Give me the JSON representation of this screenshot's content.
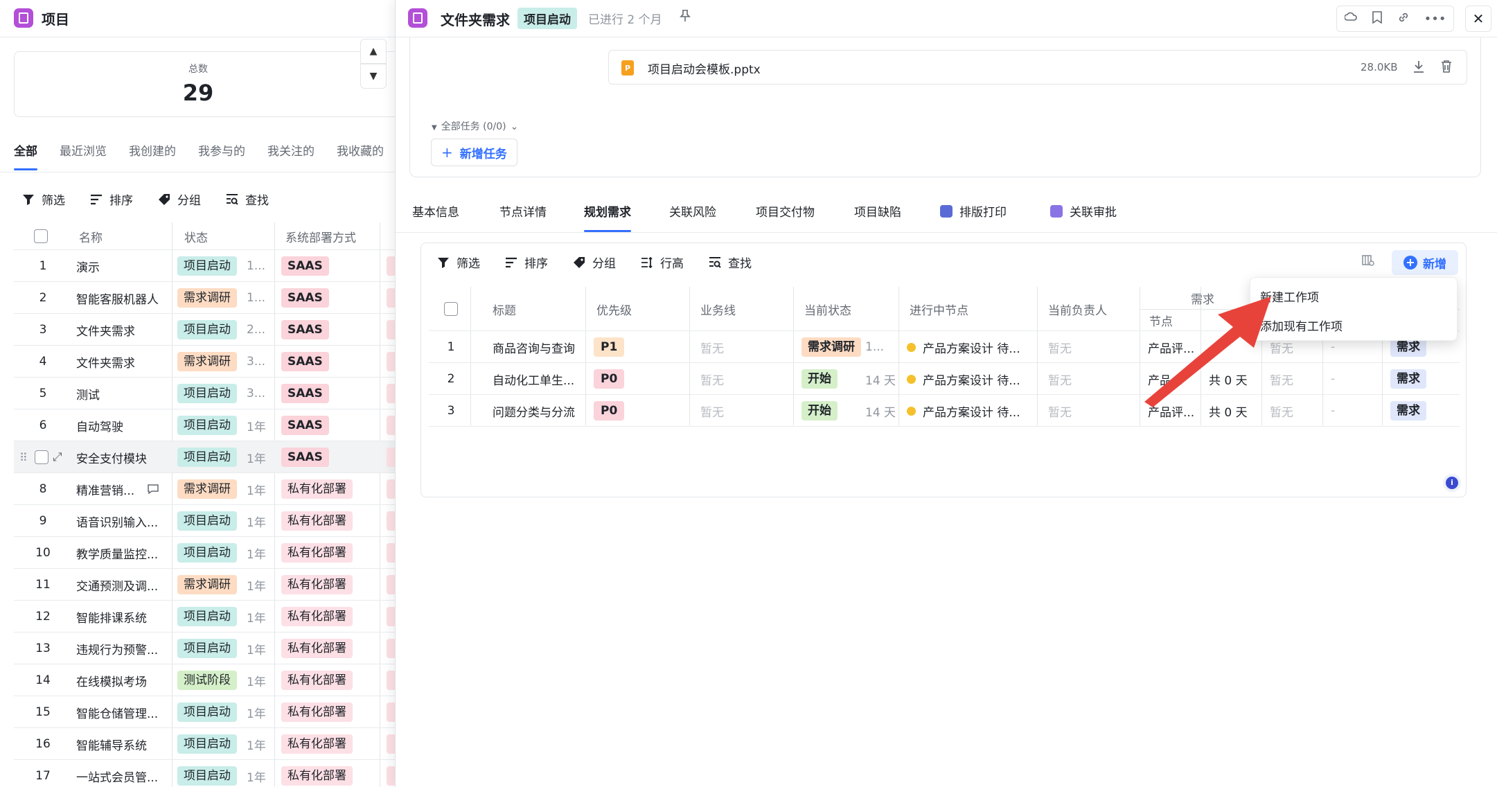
{
  "left": {
    "title": "项目",
    "stat_label": "总数",
    "stat_value": "29",
    "tabs": [
      "全部",
      "最近浏览",
      "我创建的",
      "我参与的",
      "我关注的",
      "我收藏的"
    ],
    "toolbar": [
      "筛选",
      "排序",
      "分组",
      "查找"
    ],
    "columns": [
      "名称",
      "状态",
      "系统部署方式"
    ],
    "rows": [
      {
        "num": "1",
        "name": "演示",
        "status": "项目启动",
        "status_color": "green",
        "dur": "1...",
        "deploy": "SAAS",
        "deploy_style": "pink"
      },
      {
        "num": "2",
        "name": "智能客服机器人",
        "status": "需求调研",
        "status_color": "orange",
        "dur": "1...",
        "deploy": "SAAS",
        "deploy_style": "pink"
      },
      {
        "num": "3",
        "name": "文件夹需求",
        "status": "项目启动",
        "status_color": "green",
        "dur": "2...",
        "deploy": "SAAS",
        "deploy_style": "pink"
      },
      {
        "num": "4",
        "name": "文件夹需求",
        "status": "需求调研",
        "status_color": "orange",
        "dur": "3...",
        "deploy": "SAAS",
        "deploy_style": "pink"
      },
      {
        "num": "5",
        "name": "测试",
        "status": "项目启动",
        "status_color": "green",
        "dur": "3...",
        "deploy": "SAAS",
        "deploy_style": "pink"
      },
      {
        "num": "6",
        "name": "自动驾驶",
        "status": "项目启动",
        "status_color": "green",
        "dur": "1年",
        "deploy": "SAAS",
        "deploy_style": "pink"
      },
      {
        "num": "",
        "name": "安全支付模块",
        "status": "项目启动",
        "status_color": "green",
        "dur": "1年",
        "deploy": "SAAS",
        "deploy_style": "pink"
      },
      {
        "num": "8",
        "name": "精准营销...",
        "status": "需求调研",
        "status_color": "orange",
        "dur": "1年",
        "deploy": "私有化部署",
        "deploy_style": "pink-light"
      },
      {
        "num": "9",
        "name": "语音识别输入...",
        "status": "项目启动",
        "status_color": "green",
        "dur": "1年",
        "deploy": "私有化部署",
        "deploy_style": "pink-light"
      },
      {
        "num": "10",
        "name": "教学质量监控...",
        "status": "项目启动",
        "status_color": "green",
        "dur": "1年",
        "deploy": "私有化部署",
        "deploy_style": "pink-light"
      },
      {
        "num": "11",
        "name": "交通预测及调...",
        "status": "需求调研",
        "status_color": "orange",
        "dur": "1年",
        "deploy": "私有化部署",
        "deploy_style": "pink-light"
      },
      {
        "num": "12",
        "name": "智能排课系统",
        "status": "项目启动",
        "status_color": "green",
        "dur": "1年",
        "deploy": "私有化部署",
        "deploy_style": "pink-light"
      },
      {
        "num": "13",
        "name": "违规行为预警...",
        "status": "项目启动",
        "status_color": "green",
        "dur": "1年",
        "deploy": "私有化部署",
        "deploy_style": "pink-light"
      },
      {
        "num": "14",
        "name": "在线模拟考场",
        "status": "测试阶段",
        "status_color": "lime",
        "dur": "1年",
        "deploy": "私有化部署",
        "deploy_style": "pink-light"
      },
      {
        "num": "15",
        "name": "智能仓储管理...",
        "status": "项目启动",
        "status_color": "green",
        "dur": "1年",
        "deploy": "私有化部署",
        "deploy_style": "pink-light"
      },
      {
        "num": "16",
        "name": "智能辅导系统",
        "status": "项目启动",
        "status_color": "green",
        "dur": "1年",
        "deploy": "私有化部署",
        "deploy_style": "pink-light"
      },
      {
        "num": "17",
        "name": "一站式会员管...",
        "status": "项目启动",
        "status_color": "green",
        "dur": "1年",
        "deploy": "私有化部署",
        "deploy_style": "pink-light"
      }
    ]
  },
  "detail": {
    "title": "文件夹需求",
    "status": "项目启动",
    "duration": "已进行 2 个月",
    "file": {
      "name": "项目启动会模板.pptx",
      "size": "28.0KB",
      "icon_letter": "P"
    },
    "all_tasks": "全部任务 (0/0)",
    "add_task": "新增任务",
    "tabs": [
      "基本信息",
      "节点详情",
      "规划需求",
      "关联风险",
      "项目交付物",
      "项目缺陷",
      "排版打印",
      "关联审批"
    ],
    "active_tab": "规划需求",
    "toolbar": [
      "筛选",
      "排序",
      "分组",
      "行高",
      "查找"
    ],
    "add_button": "新增",
    "columns": [
      "标题",
      "优先级",
      "业务线",
      "当前状态",
      "进行中节点",
      "当前负责人",
      "需求",
      "节点"
    ],
    "rows": [
      {
        "num": "1",
        "title": "商品咨询与查询",
        "priority": "P1",
        "biz": "暂无",
        "status": "需求调研",
        "status_extra": "1...",
        "node": "产品方案设计 待...",
        "owner": "暂无",
        "node2": "产品评...",
        "total": "",
        "c9": "暂无",
        "c10": "-",
        "type": "需求"
      },
      {
        "num": "2",
        "title": "自动化工单生...",
        "priority": "P0",
        "biz": "暂无",
        "status": "开始",
        "status_extra": "14 天",
        "node": "产品方案设计 待...",
        "owner": "暂无",
        "node2": "产品...",
        "total": "共 0 天",
        "c9": "暂无",
        "c10": "-",
        "type": "需求"
      },
      {
        "num": "3",
        "title": "问题分类与分流",
        "priority": "P0",
        "biz": "暂无",
        "status": "开始",
        "status_extra": "14 天",
        "node": "产品方案设计 待...",
        "owner": "暂无",
        "node2": "产品评...",
        "total": "共 0 天",
        "c9": "暂无",
        "c10": "-",
        "type": "需求"
      }
    ],
    "dropdown": [
      "新建工作项",
      "添加现有工作项"
    ]
  },
  "colors": {
    "accent": "#3370ff",
    "tag_green": "#c9ede9",
    "tag_orange": "#fddcc3",
    "tag_pink": "#fbd3da",
    "arrow": "#e8433b"
  }
}
